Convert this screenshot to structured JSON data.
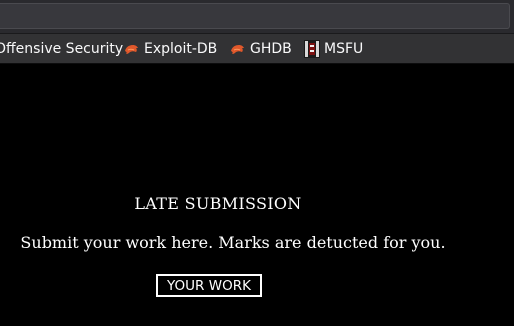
{
  "bookmarks": [
    {
      "label": "Offensive Security",
      "icon": "none"
    },
    {
      "label": "Exploit-DB",
      "icon": "kali-dragon-icon"
    },
    {
      "label": "GHDB",
      "icon": "kali-dragon-icon"
    },
    {
      "label": "MSFU",
      "icon": "msfu-icon"
    }
  ],
  "page": {
    "heading": "LATE SUBMISSION",
    "subtext": "Submit your work here. Marks are detucted for you.",
    "button_label": "YOUR WORK"
  },
  "colors": {
    "page_background": "#000000",
    "text": "#ffffff",
    "toolbar_background": "#323234",
    "dragon_icon": "#e0582b"
  }
}
